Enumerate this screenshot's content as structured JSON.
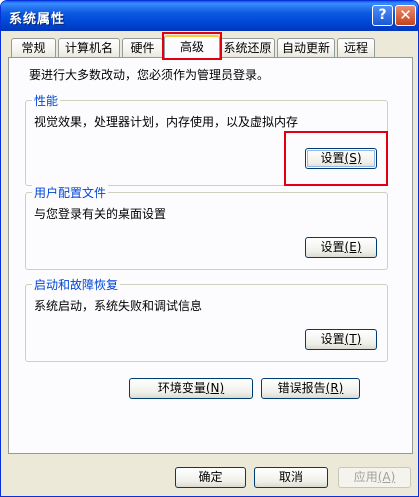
{
  "window": {
    "title": "系统属性",
    "help_label": "?",
    "close_label": "✕"
  },
  "tabs": [
    {
      "label": "常规"
    },
    {
      "label": "计算机名"
    },
    {
      "label": "硬件"
    },
    {
      "label": "高级"
    },
    {
      "label": "系统还原"
    },
    {
      "label": "自动更新"
    },
    {
      "label": "远程"
    }
  ],
  "active_tab": "高级",
  "advanced": {
    "intro": "要进行大多数改动，您必须作为管理员登录。",
    "performance": {
      "title": "性能",
      "description": "视觉效果，处理器计划，内存使用，以及虚拟内存",
      "button_label": "设置",
      "button_mnemonic": "(S)"
    },
    "user_profiles": {
      "title": "用户配置文件",
      "description": "与您登录有关的桌面设置",
      "button_label": "设置",
      "button_mnemonic": "(E)"
    },
    "startup_recovery": {
      "title": "启动和故障恢复",
      "description": "系统启动，系统失败和调试信息",
      "button_label": "设置",
      "button_mnemonic": "(T)"
    },
    "env_button_label": "环境变量",
    "env_button_mnemonic": "(N)",
    "error_button_label": "错误报告",
    "error_button_mnemonic": "(R)"
  },
  "footer": {
    "ok_label": "确定",
    "cancel_label": "取消",
    "apply_label": "应用",
    "apply_mnemonic": "(A)"
  }
}
